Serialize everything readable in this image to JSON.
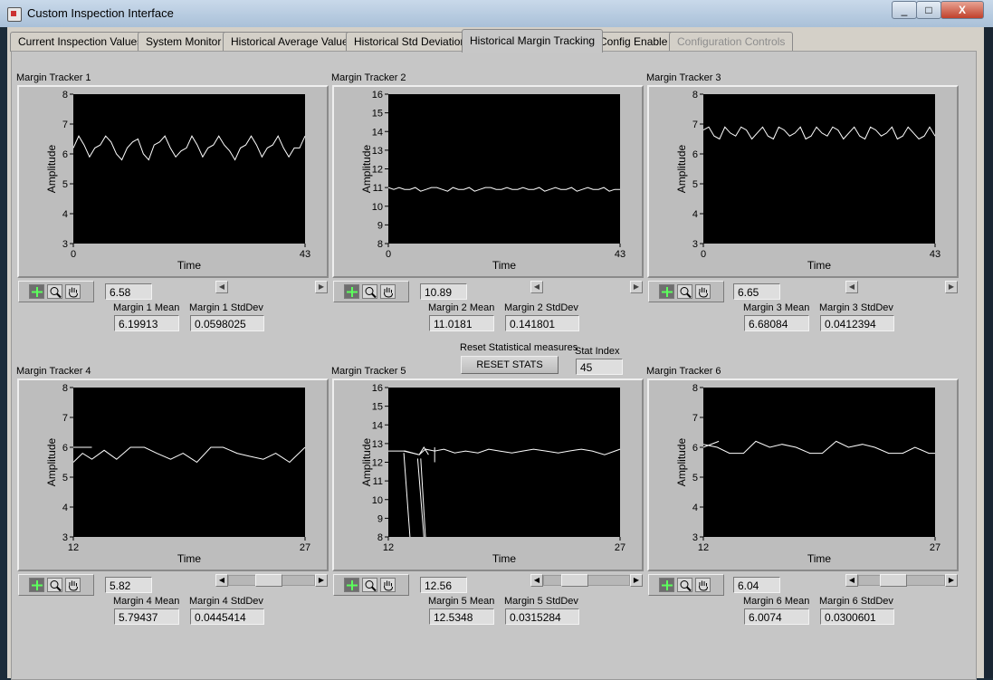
{
  "window": {
    "title": "Custom Inspection Interface",
    "minimize": "_",
    "maximize": "□",
    "close": "X"
  },
  "tabs": [
    {
      "label": "Current Inspection Values",
      "state": "normal"
    },
    {
      "label": "System Monitor",
      "state": "normal"
    },
    {
      "label": "Historical Average Value",
      "state": "normal"
    },
    {
      "label": "Historical Std Deviation",
      "state": "normal"
    },
    {
      "label": "Historical Margin Tracking",
      "state": "active"
    },
    {
      "label": "Config Enable",
      "state": "normal"
    },
    {
      "label": "Configuration Controls",
      "state": "disabled"
    }
  ],
  "reset": {
    "label": "Reset Statistical measures",
    "button": "RESET STATS"
  },
  "stat_index": {
    "label": "Stat Index",
    "value": "45"
  },
  "graphs": [
    {
      "title": "Margin Tracker 1",
      "cursor_value": "6.58",
      "mean_label": "Margin 1 Mean",
      "mean": "6.19913",
      "std_label": "Margin 1 StdDev",
      "std": "0.0598025"
    },
    {
      "title": "Margin Tracker 2",
      "cursor_value": "10.89",
      "mean_label": "Margin 2 Mean",
      "mean": "11.0181",
      "std_label": "Margin 2 StdDev",
      "std": "0.141801"
    },
    {
      "title": "Margin Tracker 3",
      "cursor_value": "6.65",
      "mean_label": "Margin 3 Mean",
      "mean": "6.68084",
      "std_label": "Margin 3 StdDev",
      "std": "0.0412394"
    },
    {
      "title": "Margin Tracker 4",
      "cursor_value": "5.82",
      "mean_label": "Margin 4 Mean",
      "mean": "5.79437",
      "std_label": "Margin 4 StdDev",
      "std": "0.0445414"
    },
    {
      "title": "Margin Tracker 5",
      "cursor_value": "12.56",
      "mean_label": "Margin 5 Mean",
      "mean": "12.5348",
      "std_label": "Margin 5 StdDev",
      "std": "0.0315284"
    },
    {
      "title": "Margin Tracker 6",
      "cursor_value": "6.04",
      "mean_label": "Margin 6 Mean",
      "mean": "6.0074",
      "std_label": "Margin 6 StdDev",
      "std": "0.0300601"
    }
  ],
  "chart_data": [
    {
      "type": "line",
      "xlabel": "Time",
      "ylabel": "Amplitude",
      "xlim": [
        0,
        43
      ],
      "ylim": [
        3,
        8
      ],
      "x_ticks": [
        "0",
        "43"
      ],
      "y_ticks": [
        "8",
        "7",
        "6",
        "5",
        "4",
        "3"
      ],
      "series": [
        {
          "y": [
            6.2,
            6.6,
            6.3,
            5.9,
            6.2,
            6.3,
            6.6,
            6.4,
            6.0,
            5.8,
            6.2,
            6.4,
            6.5,
            6.0,
            5.8,
            6.3,
            6.4,
            6.6,
            6.2,
            5.9,
            6.1,
            6.2,
            6.6,
            6.3,
            5.9,
            6.2,
            6.3,
            6.6,
            6.3,
            6.1,
            5.8,
            6.2,
            6.3,
            6.6,
            6.3,
            5.9,
            6.2,
            6.3,
            6.6,
            6.2,
            5.9,
            6.2,
            6.2,
            6.6
          ]
        }
      ]
    },
    {
      "type": "line",
      "xlabel": "Time",
      "ylabel": "Amplitude",
      "xlim": [
        0,
        43
      ],
      "ylim": [
        8,
        16
      ],
      "x_ticks": [
        "0",
        "43"
      ],
      "y_ticks": [
        "16",
        "15",
        "14",
        "13",
        "12",
        "11",
        "10",
        "9",
        "8"
      ],
      "series": [
        {
          "y": [
            11.0,
            10.9,
            11.0,
            10.9,
            10.9,
            11.0,
            10.8,
            10.9,
            11.0,
            11.0,
            10.9,
            10.8,
            11.0,
            10.9,
            10.9,
            11.0,
            10.8,
            10.9,
            11.0,
            11.0,
            10.9,
            10.9,
            11.0,
            10.9,
            10.9,
            11.0,
            10.9,
            10.9,
            11.0,
            10.8,
            10.9,
            11.0,
            10.9,
            10.9,
            11.0,
            10.8,
            10.9,
            11.0,
            10.9,
            10.9,
            11.0,
            10.8,
            10.9,
            10.9
          ]
        }
      ]
    },
    {
      "type": "line",
      "xlabel": "Time",
      "ylabel": "Amplitude",
      "xlim": [
        0,
        43
      ],
      "ylim": [
        3,
        8
      ],
      "x_ticks": [
        "0",
        "43"
      ],
      "y_ticks": [
        "8",
        "7",
        "6",
        "5",
        "4",
        "3"
      ],
      "series": [
        {
          "y": [
            6.8,
            6.9,
            6.6,
            6.5,
            6.9,
            6.7,
            6.6,
            6.9,
            6.8,
            6.5,
            6.7,
            6.9,
            6.6,
            6.5,
            6.9,
            6.8,
            6.6,
            6.7,
            6.9,
            6.5,
            6.6,
            6.9,
            6.7,
            6.6,
            6.9,
            6.8,
            6.5,
            6.7,
            6.9,
            6.6,
            6.5,
            6.9,
            6.8,
            6.6,
            6.7,
            6.9,
            6.5,
            6.6,
            6.9,
            6.7,
            6.5,
            6.6,
            6.9,
            6.6
          ]
        }
      ]
    },
    {
      "type": "line",
      "xlabel": "Time",
      "ylabel": "Amplitude",
      "xlim": [
        12,
        27
      ],
      "ylim": [
        3,
        8
      ],
      "x_ticks": [
        "12",
        "27"
      ],
      "y_ticks": [
        "8",
        "7",
        "6",
        "5",
        "4",
        "3"
      ],
      "series": [
        {
          "x": [
            12,
            12.6,
            13.2,
            14,
            14.8,
            15.7,
            16.6,
            17.4,
            18.3,
            19.1,
            20,
            20.9,
            21.7,
            22.6,
            23.4,
            24.3,
            25.1,
            26,
            27
          ],
          "y": [
            5.5,
            5.8,
            5.6,
            5.9,
            5.6,
            6.0,
            6.0,
            5.8,
            5.6,
            5.8,
            5.5,
            6.0,
            6.0,
            5.8,
            5.7,
            5.6,
            5.8,
            5.5,
            6.0
          ]
        },
        {
          "x": [
            12,
            13.2
          ],
          "y": [
            6.0,
            6.0
          ]
        }
      ]
    },
    {
      "type": "line",
      "xlabel": "Time",
      "ylabel": "Amplitude",
      "xlim": [
        12,
        27
      ],
      "ylim": [
        8,
        16
      ],
      "x_ticks": [
        "12",
        "27"
      ],
      "y_ticks": [
        "16",
        "15",
        "14",
        "13",
        "12",
        "11",
        "10",
        "9",
        "8"
      ],
      "series": [
        {
          "x": [
            12,
            13.1,
            14,
            14.4,
            15,
            15.6,
            16.3,
            17,
            17.8,
            18.5,
            19.2,
            20,
            20.7,
            21.4,
            22.2,
            23,
            23.7,
            24.5,
            25.2,
            26,
            27
          ],
          "y": [
            12.6,
            12.6,
            12.4,
            12.7,
            12.6,
            12.7,
            12.5,
            12.6,
            12.5,
            12.7,
            12.6,
            12.5,
            12.6,
            12.7,
            12.6,
            12.5,
            12.6,
            12.7,
            12.6,
            12.4,
            12.7
          ]
        },
        {
          "x": [
            13.0,
            14.0,
            14.3,
            14.6
          ],
          "y": [
            12.6,
            12.4,
            12.8,
            12.4
          ]
        },
        {
          "x": [
            13.0,
            13.4
          ],
          "y": [
            12.5,
            8.0
          ]
        },
        {
          "x": [
            13.9,
            14.3
          ],
          "y": [
            12.2,
            8.0
          ]
        },
        {
          "x": [
            14.1,
            14.4
          ],
          "y": [
            12.2,
            8.0
          ]
        },
        {
          "x": [
            15.0,
            15.0
          ],
          "y": [
            12.8,
            12.0
          ]
        }
      ]
    },
    {
      "type": "line",
      "xlabel": "Time",
      "ylabel": "Amplitude",
      "xlim": [
        12,
        27
      ],
      "ylim": [
        3,
        8
      ],
      "x_ticks": [
        "12",
        "27"
      ],
      "y_ticks": [
        "8",
        "7",
        "6",
        "5",
        "4",
        "3"
      ],
      "series": [
        {
          "x": [
            12,
            12.9,
            13.7,
            14.6,
            15.4,
            16.3,
            17.1,
            18,
            18.9,
            19.7,
            20.6,
            21.4,
            22.3,
            23.1,
            24,
            24.9,
            25.7,
            26.6,
            27
          ],
          "y": [
            6.1,
            6.0,
            5.8,
            5.8,
            6.2,
            6.0,
            6.1,
            6.0,
            5.8,
            5.8,
            6.2,
            6.0,
            6.1,
            6.0,
            5.8,
            5.8,
            6.0,
            5.8,
            5.8
          ]
        },
        {
          "x": [
            12,
            13.0
          ],
          "y": [
            6.0,
            6.2
          ]
        }
      ]
    }
  ]
}
